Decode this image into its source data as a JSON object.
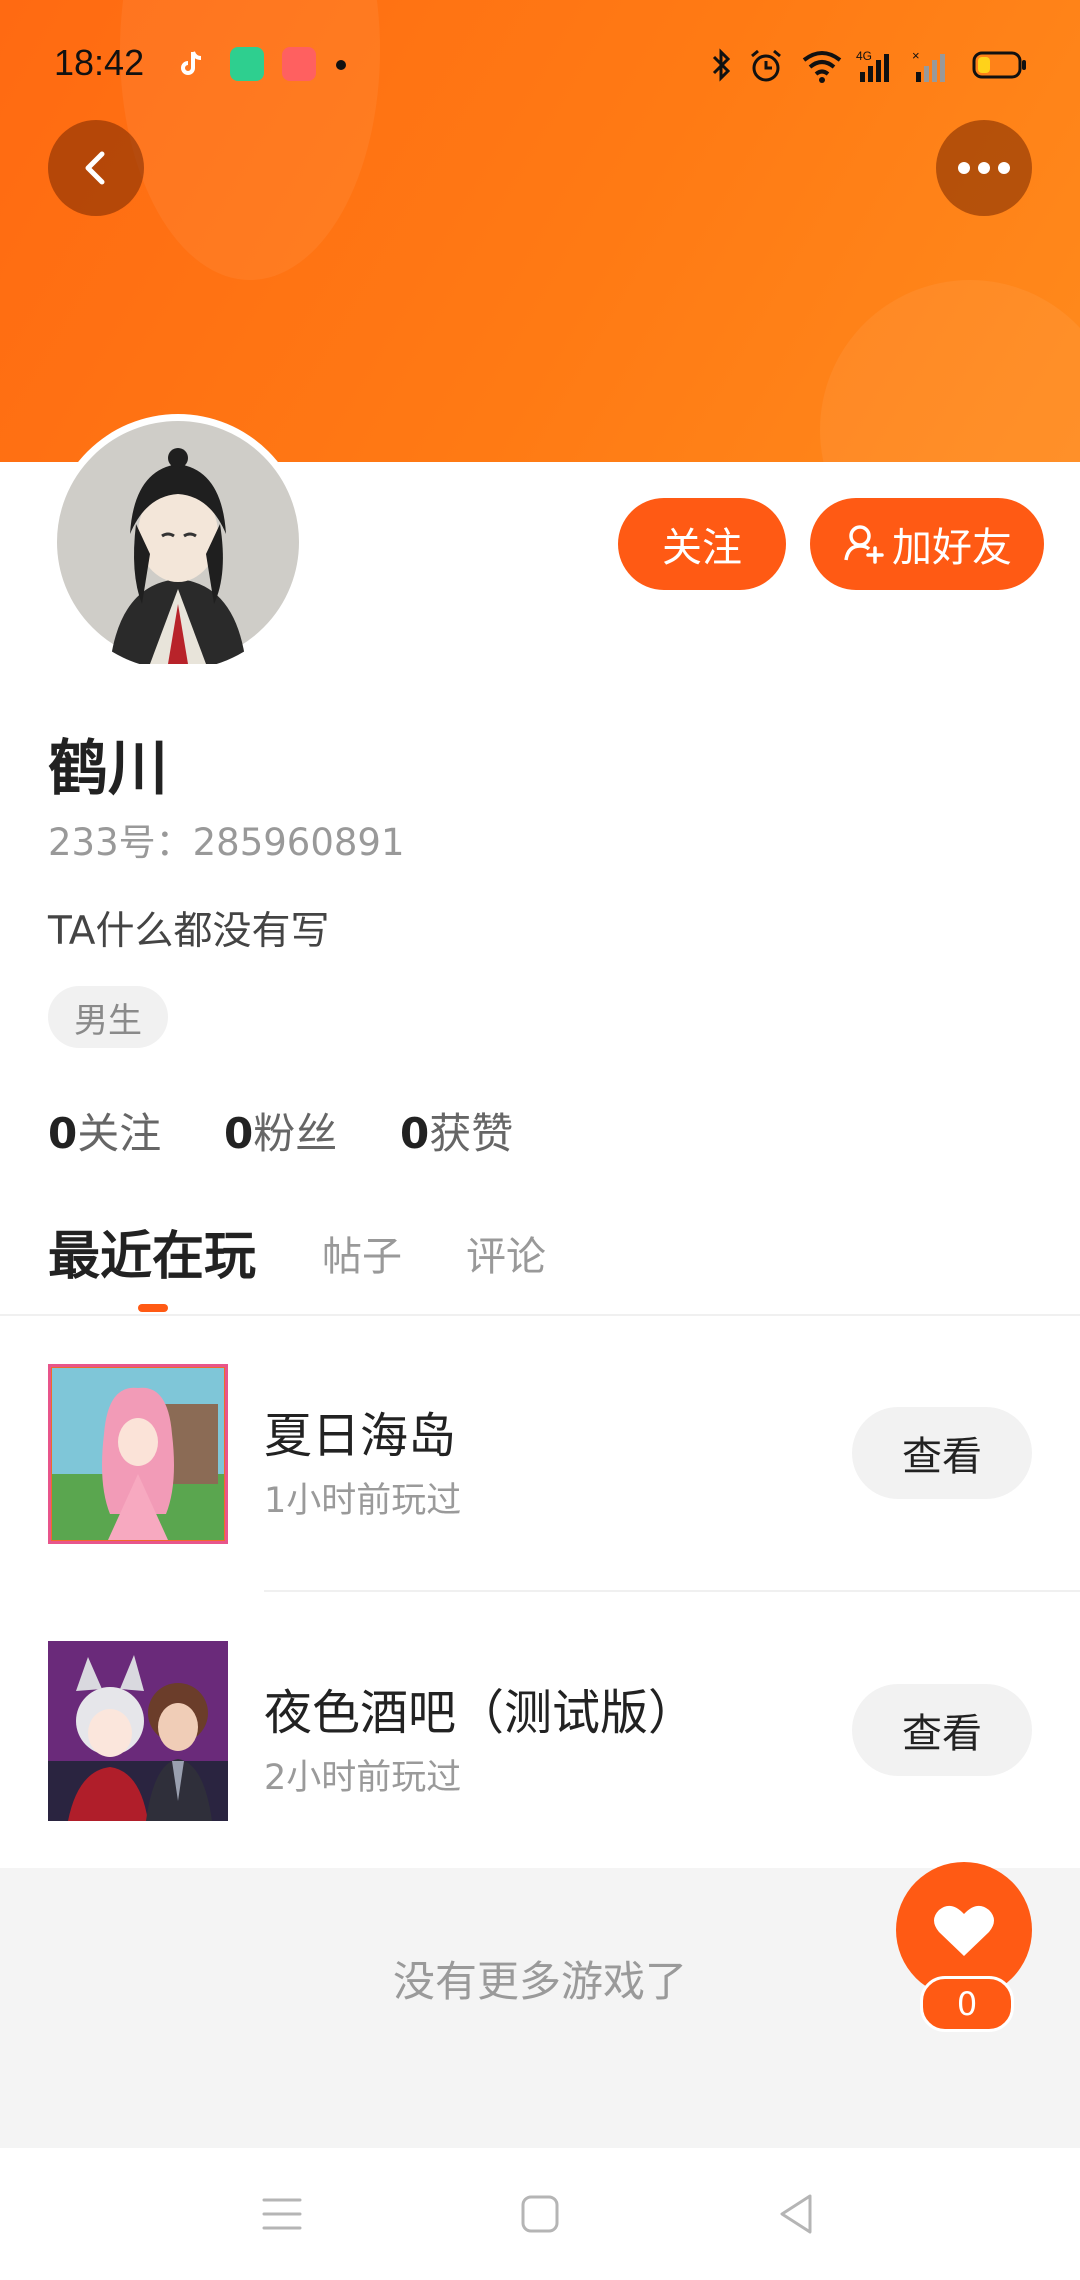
{
  "status_bar": {
    "time": "18:42"
  },
  "profile": {
    "nickname": "鹤川",
    "uid_label": "233号：285960891",
    "bio": "TA什么都没有写",
    "gender_tag": "男生"
  },
  "actions": {
    "follow_label": "关注",
    "add_friend_label": "加好友"
  },
  "stats": [
    {
      "count": "0",
      "label": "关注"
    },
    {
      "count": "0",
      "label": "粉丝"
    },
    {
      "count": "0",
      "label": "获赞"
    }
  ],
  "tabs": [
    {
      "label": "最近在玩",
      "active": true
    },
    {
      "label": "帖子",
      "active": false
    },
    {
      "label": "评论",
      "active": false
    }
  ],
  "games": [
    {
      "title": "夏日海岛",
      "played": "1小时前玩过",
      "button": "查看"
    },
    {
      "title": "夜色酒吧（测试版）",
      "played": "2小时前玩过",
      "button": "查看"
    }
  ],
  "list_end_text": "没有更多游戏了",
  "like": {
    "count": "0"
  },
  "colors": {
    "accent": "#ff5a14",
    "banner": "#ff7a14"
  }
}
